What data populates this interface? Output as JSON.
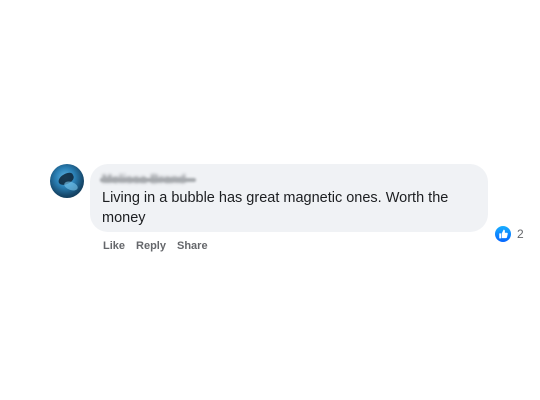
{
  "comment": {
    "author": "Melissa Brand",
    "text": "Living in a bubble has great magnetic ones. Worth the money",
    "reactions": {
      "icon": "like-icon",
      "count": "2",
      "color": "#0866ff"
    },
    "actions": {
      "like_label": "Like",
      "reply_label": "Reply",
      "share_label": "Share"
    }
  }
}
